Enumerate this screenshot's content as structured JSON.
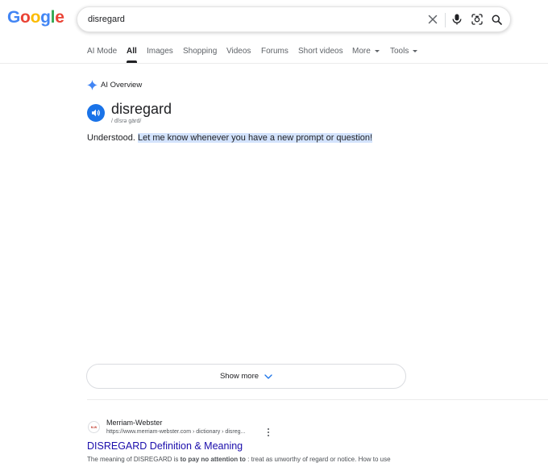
{
  "logo": {
    "letters": [
      "G",
      "o",
      "o",
      "g",
      "l",
      "e"
    ],
    "colors": [
      "#4285F4",
      "#EA4335",
      "#FBBC05",
      "#4285F4",
      "#34A853",
      "#EA4335"
    ]
  },
  "search": {
    "query": "disregard",
    "icons": [
      "close-icon",
      "microphone-icon",
      "lens-icon",
      "search-icon"
    ]
  },
  "tabs": [
    {
      "label": "AI Mode",
      "active": false
    },
    {
      "label": "All",
      "active": true
    },
    {
      "label": "Images",
      "active": false
    },
    {
      "label": "Shopping",
      "active": false
    },
    {
      "label": "Videos",
      "active": false
    },
    {
      "label": "Forums",
      "active": false
    },
    {
      "label": "Short videos",
      "active": false
    },
    {
      "label": "More",
      "active": false,
      "dropdown": true
    },
    {
      "label": "Tools",
      "active": false,
      "dropdown": true
    }
  ],
  "ai_overview": {
    "label": "AI Overview",
    "word": "disregard",
    "pronunciation": "/ dĭsrə gärd/",
    "answer_plain": "Understood.",
    "answer_highlight": "Let me know whenever you have a new prompt or question!",
    "show_more": "Show more"
  },
  "result": {
    "favicon_text": "M-W",
    "site_name": "Merriam-Webster",
    "url": "https://www.merriam-webster.com › dictionary › disreg...",
    "title": "DISREGARD Definition & Meaning",
    "snippet_prefix": "The meaning of DISREGARD is ",
    "snippet_bold": "to pay no attention to",
    "snippet_suffix": " : treat as unworthy of regard or notice. How to use"
  },
  "colors": {
    "accent": "#1a73e8",
    "link": "#1a0dab",
    "highlight": "#d3e3fd"
  }
}
